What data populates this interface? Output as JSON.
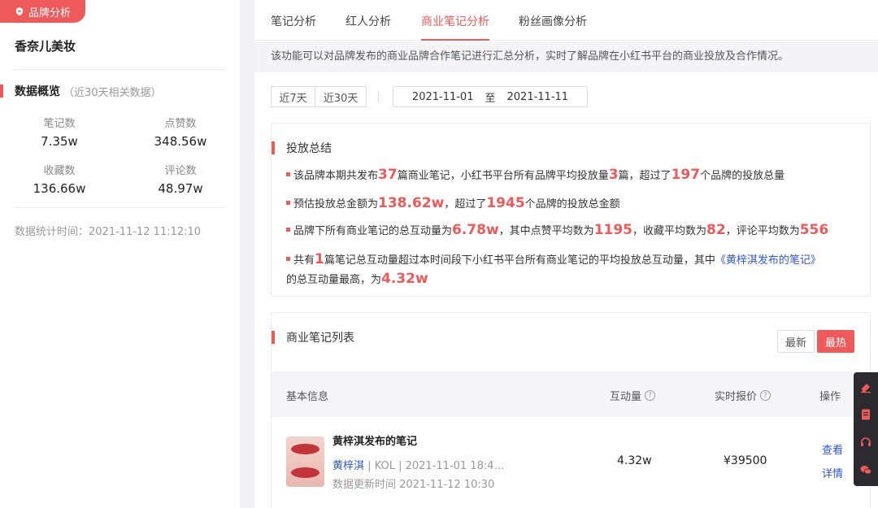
{
  "left": {
    "tag_label": "品牌分析",
    "brand_name": "香奈儿美妆",
    "overview_title": "数据概览",
    "overview_sub": "（近30天相关数据）",
    "stats": [
      {
        "label": "笔记数",
        "value": "7.35w"
      },
      {
        "label": "点赞数",
        "value": "348.56w"
      },
      {
        "label": "收藏数",
        "value": "136.66w"
      },
      {
        "label": "评论数",
        "value": "48.97w"
      }
    ],
    "stat_time": "数据统计时间：2021-11-12 11:12:10"
  },
  "tabs": [
    "笔记分析",
    "红人分析",
    "商业笔记分析",
    "粉丝画像分析"
  ],
  "active_tab": 2,
  "notice": "该功能可以对品牌发布的商业品牌合作笔记进行汇总分析，实时了解品牌在小红书平台的商业投放及合作情况。",
  "filter": {
    "btn_7": "近7天",
    "btn_30": "近30天",
    "date_start": "2021-11-01",
    "date_to": "至",
    "date_end": "2021-11-11"
  },
  "summary": {
    "title": "投放总结",
    "l1": {
      "a": "该品牌本期共发布",
      "n1": "37",
      "b": "篇商业笔记，小红书平台所有品牌平均投放量",
      "n2": "3",
      "c": "篇，超过了",
      "n3": "197",
      "d": "个品牌的投放总量"
    },
    "l2": {
      "a": "预估投放总金额为",
      "n1": "138.62w",
      "b": "，超过了",
      "n2": "1945",
      "c": "个品牌的投放总金额"
    },
    "l3": {
      "a": "品牌下所有商业笔记的总互动量为",
      "n1": "6.78w",
      "b": "，其中点赞平均数为",
      "n2": "1195",
      "c": "，收藏平均数为",
      "n3": "82",
      "d": "，评论平均数为",
      "n4": "556"
    },
    "l4": {
      "a": "共有",
      "n1": "1",
      "b": "篇笔记总互动量超过本时间段下小红书平台所有商业笔记的平均投放总互动量，其中",
      "link": "《黄梓淇发布的笔记》",
      "c": "的总互动量最高，为",
      "n2": "4.32w"
    }
  },
  "list": {
    "title": "商业笔记列表",
    "sort_new": "最新",
    "sort_hot": "最热",
    "columns": {
      "basic": "基本信息",
      "interaction": "互动量",
      "price": "实时报价",
      "op": "操作"
    },
    "help_glyph": "?",
    "rows": [
      {
        "title": "黄梓淇发布的笔记",
        "author": "黄梓淇",
        "sep": "|",
        "meta": "KOL | 2021-11-01 18:4…",
        "update": "数据更新时间 2021-11-12 10:30",
        "interaction": "4.32w",
        "price": "¥39500",
        "op_view": "查看",
        "op_detail": "详情"
      }
    ]
  },
  "colors": {
    "accent": "#ee5a5a",
    "link": "#2f54eb"
  }
}
